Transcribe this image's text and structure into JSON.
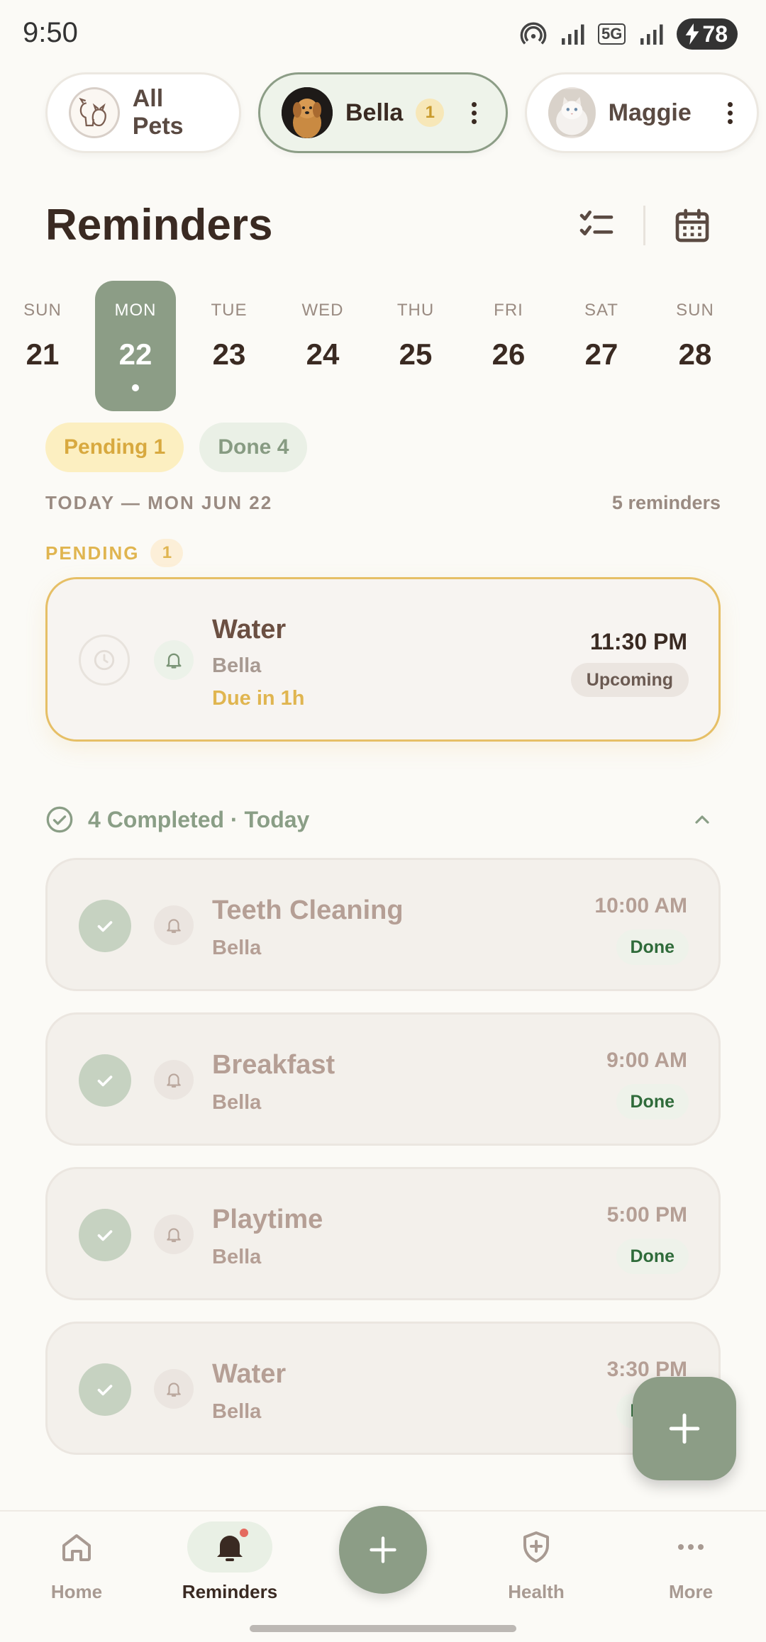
{
  "status_bar": {
    "time": "9:50",
    "network": "5G",
    "battery": "78"
  },
  "pets": [
    {
      "name": "All Pets",
      "badge": ""
    },
    {
      "name": "Bella",
      "badge": "1"
    },
    {
      "name": "Maggie",
      "badge": ""
    }
  ],
  "header": {
    "title": "Reminders"
  },
  "week": [
    {
      "dow": "SUN",
      "num": "21"
    },
    {
      "dow": "MON",
      "num": "22"
    },
    {
      "dow": "TUE",
      "num": "23"
    },
    {
      "dow": "WED",
      "num": "24"
    },
    {
      "dow": "THU",
      "num": "25"
    },
    {
      "dow": "FRI",
      "num": "26"
    },
    {
      "dow": "SAT",
      "num": "27"
    },
    {
      "dow": "SUN",
      "num": "28"
    }
  ],
  "filters": {
    "pending": "Pending 1",
    "done": "Done 4"
  },
  "section": {
    "date": "TODAY — MON JUN 22",
    "count": "5 reminders",
    "pending_label": "PENDING",
    "pending_count": "1"
  },
  "pending_card": {
    "title": "Water",
    "pet": "Bella",
    "due": "Due in 1h",
    "time": "11:30 PM",
    "status": "Upcoming"
  },
  "completed": {
    "header": "4 Completed · Today",
    "items": [
      {
        "title": "Teeth Cleaning",
        "pet": "Bella",
        "time": "10:00 AM",
        "status": "Done"
      },
      {
        "title": "Breakfast",
        "pet": "Bella",
        "time": "9:00 AM",
        "status": "Done"
      },
      {
        "title": "Playtime",
        "pet": "Bella",
        "time": "5:00 PM",
        "status": "Done"
      },
      {
        "title": "Water",
        "pet": "Bella",
        "time": "3:30 PM",
        "status": "Done"
      }
    ]
  },
  "nav": {
    "home": "Home",
    "reminders": "Reminders",
    "health": "Health",
    "more": "More"
  },
  "colors": {
    "accent": "#8c9d86",
    "pending": "#e0b550",
    "done_text": "#2f6b3a",
    "brown": "#3a2a22"
  }
}
